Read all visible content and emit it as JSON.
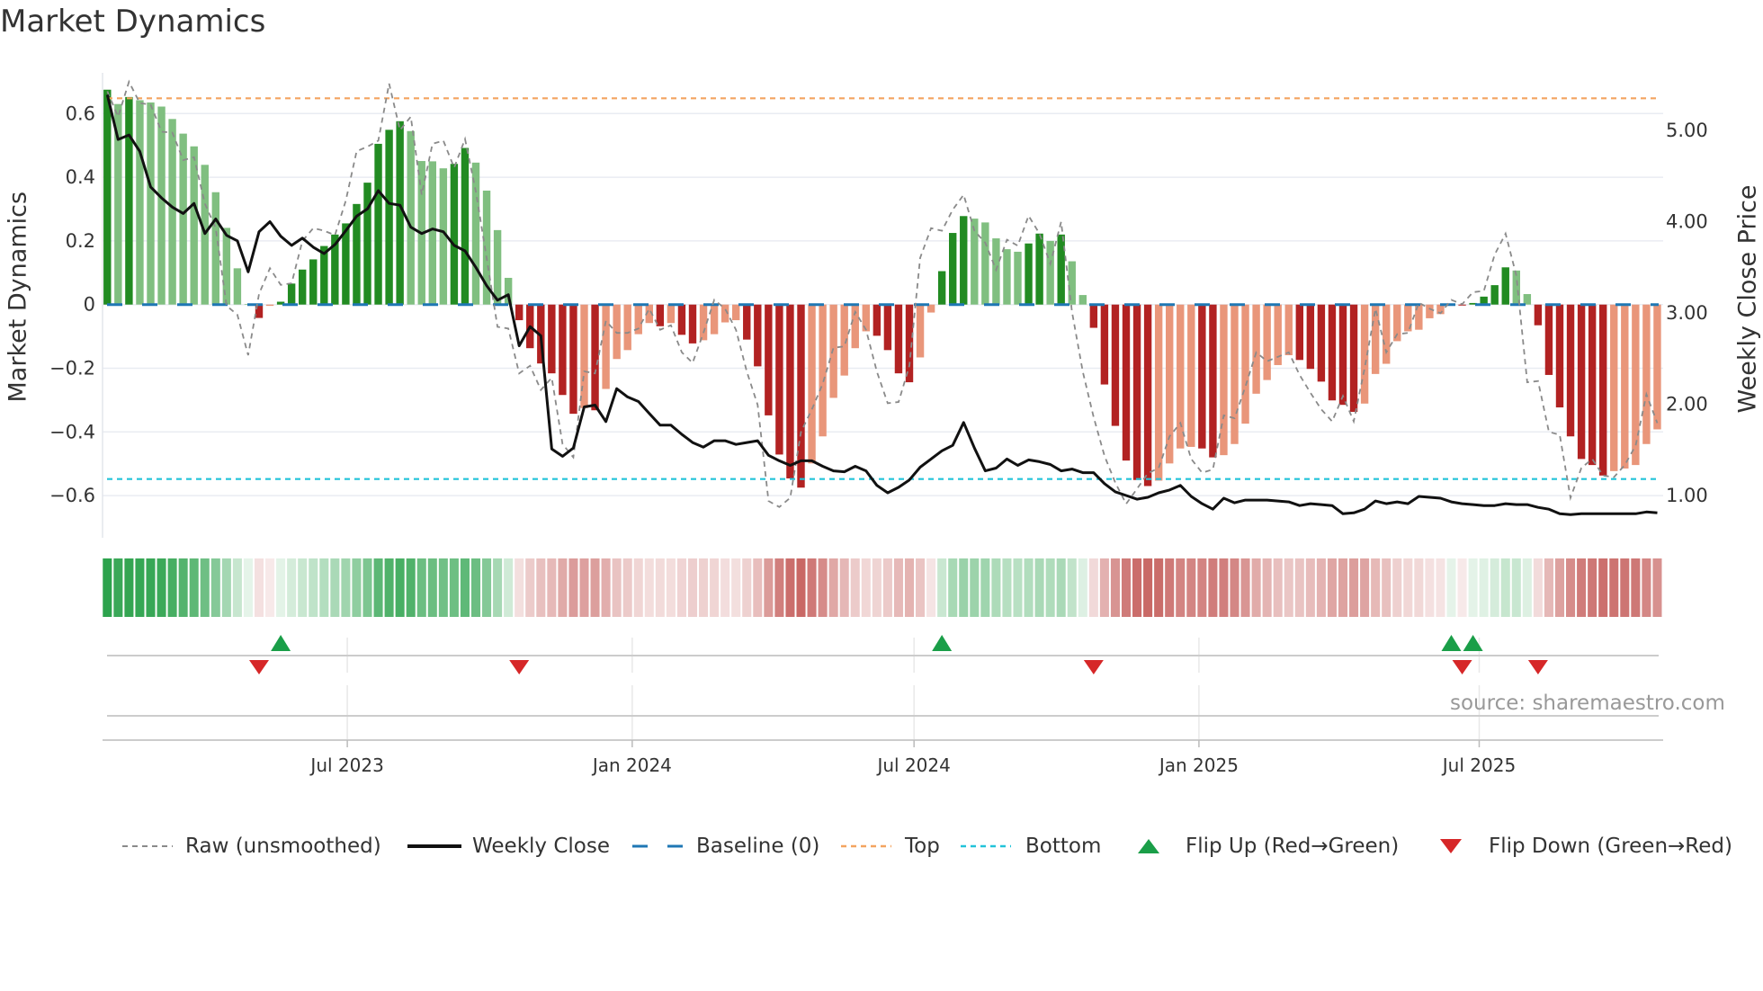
{
  "title": "Market Dynamics",
  "source": "source: sharemaestro.com",
  "colors": {
    "bar_pos_strong": "#228b22",
    "bar_pos_weak": "#80bf80",
    "bar_neg_strong": "#b22222",
    "bar_neg_weak": "#e9967a",
    "raw": "#8a8a8a",
    "close": "#111111",
    "baseline": "#1f77b4",
    "top": "#f4a460",
    "bottom": "#22c3d9",
    "flip_up": "#1a9e48",
    "flip_down": "#d62728",
    "strip_pos": "#2ca24c",
    "strip_neg": "#c0504d"
  },
  "legend": [
    {
      "key": "raw",
      "label": "Raw (unsmoothed)"
    },
    {
      "key": "close",
      "label": "Weekly Close"
    },
    {
      "key": "baseline",
      "label": "Baseline (0)"
    },
    {
      "key": "top",
      "label": "Top"
    },
    {
      "key": "bottom",
      "label": "Bottom"
    },
    {
      "key": "flip_up",
      "label": "Flip Up (Red→Green)"
    },
    {
      "key": "flip_down",
      "label": "Flip Down (Green→Red)"
    }
  ],
  "chart_data": {
    "type": "bar",
    "title": "Market Dynamics",
    "ylabel": "Market Dynamics",
    "y2label": "Weekly Close Price",
    "x_start": "2023-01-27",
    "x_step_days": 7,
    "ylim": [
      -0.733,
      0.728
    ],
    "y2lim": [
      0.54,
      5.63
    ],
    "yticks": [
      -0.6,
      -0.4,
      -0.2,
      0,
      0.2,
      0.4,
      0.6
    ],
    "ytick_labels": [
      "−0.6",
      "−0.4",
      "−0.2",
      "0",
      "0.2",
      "0.4",
      "0.6"
    ],
    "y2ticks": [
      1,
      2,
      3,
      4,
      5
    ],
    "y2tick_labels": [
      "1.00",
      "2.00",
      "3.00",
      "4.00",
      "5.00"
    ],
    "xticks": [
      {
        "date": "2023-07-01",
        "label": "Jul 2023"
      },
      {
        "date": "2024-01-01",
        "label": "Jan 2024"
      },
      {
        "date": "2024-07-01",
        "label": "Jul 2024"
      },
      {
        "date": "2025-01-01",
        "label": "Jan 2025"
      },
      {
        "date": "2025-07-01",
        "label": "Jul 2025"
      }
    ],
    "grid": true,
    "legend_position": "bottom",
    "top_level": 0.648,
    "bottom_level": -0.548,
    "baseline": 0,
    "series": [
      {
        "name": "Market Dynamics",
        "type": "bar",
        "values": [
          0.675,
          0.63,
          0.652,
          0.642,
          0.635,
          0.622,
          0.583,
          0.537,
          0.497,
          0.439,
          0.353,
          0.241,
          0.114,
          0.002,
          -0.042,
          -0.004,
          0.009,
          0.066,
          0.11,
          0.142,
          0.184,
          0.22,
          0.255,
          0.316,
          0.383,
          0.505,
          0.549,
          0.576,
          0.545,
          0.451,
          0.45,
          0.428,
          0.442,
          0.492,
          0.446,
          0.358,
          0.234,
          0.084,
          -0.049,
          -0.137,
          -0.185,
          -0.216,
          -0.284,
          -0.343,
          -0.325,
          -0.332,
          -0.265,
          -0.171,
          -0.143,
          -0.093,
          -0.058,
          -0.068,
          -0.058,
          -0.095,
          -0.122,
          -0.112,
          -0.093,
          -0.056,
          -0.049,
          -0.11,
          -0.194,
          -0.348,
          -0.471,
          -0.546,
          -0.575,
          -0.499,
          -0.414,
          -0.293,
          -0.223,
          -0.137,
          -0.084,
          -0.098,
          -0.143,
          -0.216,
          -0.244,
          -0.166,
          -0.025,
          0.105,
          0.225,
          0.278,
          0.27,
          0.258,
          0.208,
          0.174,
          0.166,
          0.192,
          0.223,
          0.2,
          0.22,
          0.136,
          0.03,
          -0.073,
          -0.251,
          -0.381,
          -0.49,
          -0.551,
          -0.57,
          -0.553,
          -0.499,
          -0.452,
          -0.447,
          -0.452,
          -0.48,
          -0.473,
          -0.438,
          -0.374,
          -0.28,
          -0.237,
          -0.19,
          -0.159,
          -0.174,
          -0.202,
          -0.242,
          -0.301,
          -0.315,
          -0.337,
          -0.311,
          -0.218,
          -0.186,
          -0.115,
          -0.084,
          -0.079,
          -0.043,
          -0.03,
          0.003,
          -0.003,
          0.005,
          0.025,
          0.061,
          0.117,
          0.107,
          0.033,
          -0.065,
          -0.221,
          -0.323,
          -0.414,
          -0.485,
          -0.504,
          -0.537,
          -0.523,
          -0.515,
          -0.504,
          -0.438,
          -0.392
        ]
      },
      {
        "name": "Raw (unsmoothed)",
        "type": "line",
        "values": [
          0.67,
          0.59,
          0.7,
          0.633,
          0.628,
          0.543,
          0.54,
          0.454,
          0.463,
          0.317,
          0.24,
          -0.004,
          -0.032,
          -0.159,
          0.034,
          0.114,
          0.062,
          0.067,
          0.2,
          0.24,
          0.232,
          0.218,
          0.326,
          0.482,
          0.496,
          0.515,
          0.694,
          0.548,
          0.59,
          0.345,
          0.505,
          0.515,
          0.43,
          0.52,
          0.355,
          0.147,
          -0.07,
          -0.075,
          -0.216,
          -0.192,
          -0.268,
          -0.23,
          -0.438,
          -0.48,
          -0.21,
          -0.216,
          -0.051,
          -0.089,
          -0.089,
          -0.075,
          -0.013,
          -0.079,
          -0.065,
          -0.15,
          -0.183,
          -0.089,
          0.015,
          -0.013,
          -0.079,
          -0.211,
          -0.315,
          -0.617,
          -0.636,
          -0.607,
          -0.4,
          -0.33,
          -0.249,
          -0.136,
          -0.131,
          -0.023,
          -0.079,
          -0.211,
          -0.31,
          -0.306,
          -0.192,
          0.147,
          0.24,
          0.232,
          0.298,
          0.345,
          0.232,
          0.194,
          0.109,
          0.204,
          0.185,
          0.279,
          0.223,
          0.128,
          0.26,
          -0.023,
          -0.211,
          -0.353,
          -0.475,
          -0.56,
          -0.626,
          -0.579,
          -0.53,
          -0.513,
          -0.414,
          -0.372,
          -0.485,
          -0.528,
          -0.518,
          -0.348,
          -0.357,
          -0.258,
          -0.15,
          -0.178,
          -0.164,
          -0.15,
          -0.221,
          -0.277,
          -0.329,
          -0.367,
          -0.287,
          -0.367,
          -0.2,
          -0.013,
          -0.15,
          -0.093,
          -0.089,
          0.006,
          -0.013,
          -0.027,
          0.015,
          0.001,
          0.039,
          0.043,
          0.157,
          0.223,
          0.091,
          -0.244,
          -0.24,
          -0.4,
          -0.409,
          -0.607,
          -0.513,
          -0.485,
          -0.537,
          -0.542,
          -0.504,
          -0.443,
          -0.282,
          -0.372
        ]
      },
      {
        "name": "Weekly Close",
        "type": "line",
        "axis": "right",
        "values": [
          5.39,
          4.9,
          4.95,
          4.77,
          4.38,
          4.26,
          4.16,
          4.09,
          4.2,
          3.87,
          4.03,
          3.85,
          3.79,
          3.45,
          3.89,
          4.0,
          3.84,
          3.74,
          3.82,
          3.72,
          3.65,
          3.75,
          3.9,
          4.06,
          4.14,
          4.34,
          4.2,
          4.18,
          3.94,
          3.87,
          3.92,
          3.89,
          3.74,
          3.68,
          3.5,
          3.3,
          3.14,
          3.2,
          2.64,
          2.85,
          2.75,
          1.51,
          1.43,
          1.52,
          1.97,
          1.99,
          1.81,
          2.17,
          2.08,
          2.03,
          1.9,
          1.77,
          1.77,
          1.67,
          1.58,
          1.53,
          1.6,
          1.6,
          1.56,
          1.58,
          1.6,
          1.44,
          1.38,
          1.33,
          1.38,
          1.38,
          1.32,
          1.27,
          1.26,
          1.32,
          1.27,
          1.11,
          1.03,
          1.09,
          1.17,
          1.31,
          1.4,
          1.49,
          1.55,
          1.8,
          1.52,
          1.27,
          1.3,
          1.4,
          1.33,
          1.39,
          1.37,
          1.34,
          1.27,
          1.29,
          1.25,
          1.25,
          1.13,
          1.04,
          1.0,
          0.96,
          0.98,
          1.03,
          1.06,
          1.11,
          0.99,
          0.91,
          0.85,
          0.97,
          0.92,
          0.95,
          0.95,
          0.95,
          0.94,
          0.93,
          0.89,
          0.91,
          0.9,
          0.89,
          0.8,
          0.81,
          0.85,
          0.94,
          0.91,
          0.93,
          0.91,
          0.99,
          0.98,
          0.97,
          0.93,
          0.91,
          0.9,
          0.89,
          0.89,
          0.91,
          0.9,
          0.9,
          0.87,
          0.85,
          0.8,
          0.79,
          0.8,
          0.8,
          0.8,
          0.8,
          0.8,
          0.8,
          0.82,
          0.81
        ]
      }
    ],
    "flip_up_index": [
      16,
      77,
      124,
      126
    ],
    "flip_down_index": [
      14,
      38,
      91,
      125,
      132
    ]
  }
}
